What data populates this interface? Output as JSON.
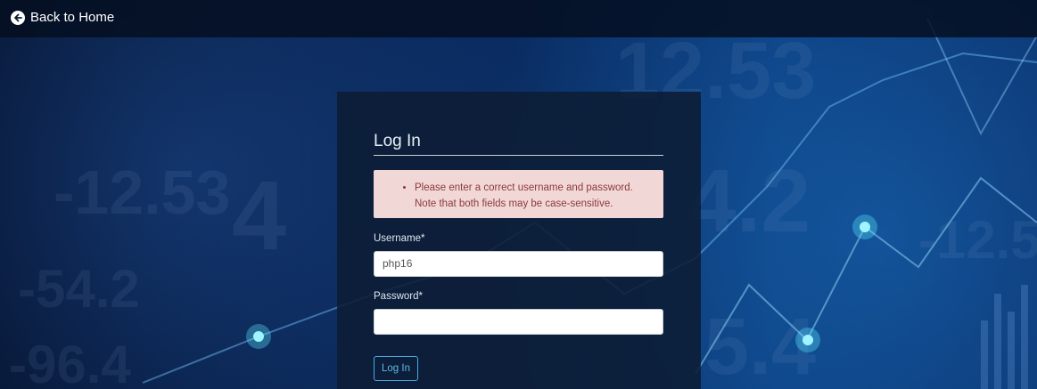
{
  "nav": {
    "back_label": "Back to Home"
  },
  "login": {
    "title": "Log In",
    "error_message": "Please enter a correct username and password. Note that both fields may be case-sensitive.",
    "username_label": "Username*",
    "username_value": "php16",
    "password_label": "Password*",
    "password_value": "",
    "submit_label": "Log In"
  },
  "background_numbers": [
    "12.53",
    "-12.53",
    "-54.2",
    "4",
    "-96.4",
    "4.2",
    "-12.5",
    "5.4"
  ],
  "colors": {
    "topbar": "#050e20",
    "panel": "#0c1c34",
    "alert_bg": "#f2d7d7",
    "alert_text": "#8a3a3a",
    "accent": "#4aa8e0"
  }
}
